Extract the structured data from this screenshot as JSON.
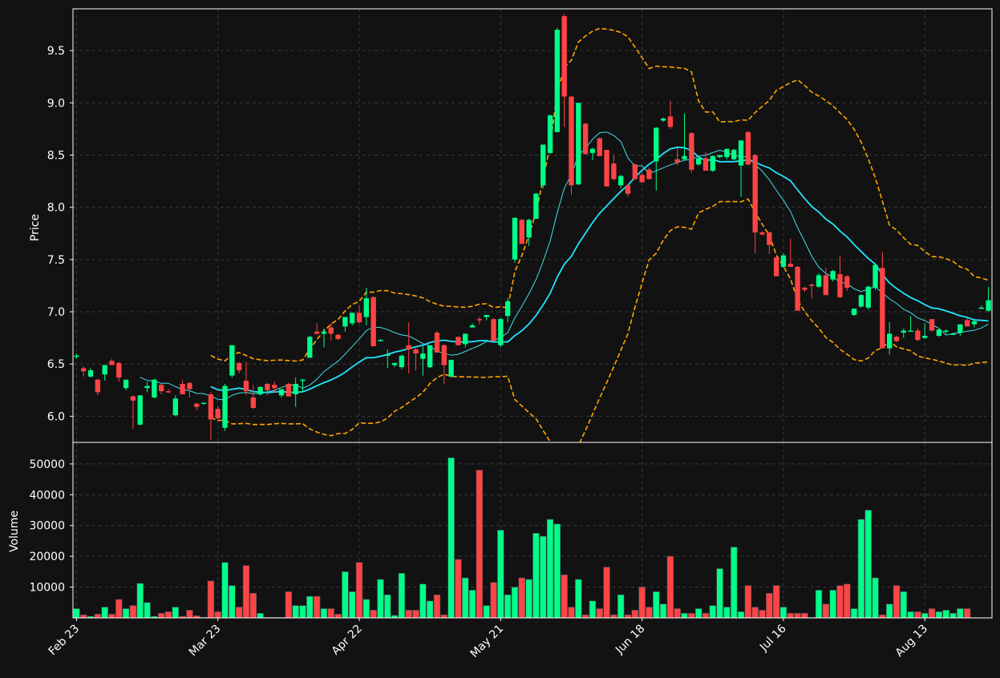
{
  "chart_data": [
    {
      "type": "candlestick",
      "panel": "price",
      "ylabel": "Price",
      "ylim": [
        5.75,
        9.9
      ],
      "yticks": [
        6.0,
        6.5,
        7.0,
        7.5,
        8.0,
        8.5,
        9.0,
        9.5
      ],
      "ytick_labels": [
        "6.0",
        "6.5",
        "7.0",
        "7.5",
        "8.0",
        "8.5",
        "9.0",
        "9.5"
      ],
      "x_tick_labels": [
        "Feb 23",
        "Mar 23",
        "Apr 22",
        "May 21",
        "Jun 18",
        "Jul 16",
        "Aug 13"
      ],
      "x_tick_indices": [
        0,
        20,
        40,
        60,
        80,
        100,
        120
      ],
      "grid": true,
      "colors": {
        "up": "#00ff88",
        "down": "#ff4444",
        "band": "#ffa500",
        "ma_short": "#40e0e8",
        "ma_long": "#22e4ff",
        "background": "#121212"
      },
      "ohlc": [
        [
          6.58,
          6.6,
          6.55,
          6.58
        ],
        [
          6.46,
          6.48,
          6.38,
          6.43
        ],
        [
          6.38,
          6.46,
          6.37,
          6.44
        ],
        [
          6.35,
          6.36,
          6.2,
          6.23
        ],
        [
          6.4,
          6.49,
          6.34,
          6.49
        ],
        [
          6.53,
          6.55,
          6.49,
          6.49
        ],
        [
          6.51,
          6.52,
          6.33,
          6.37
        ],
        [
          6.27,
          6.35,
          6.25,
          6.35
        ],
        [
          6.19,
          6.2,
          5.88,
          6.15
        ],
        [
          5.92,
          6.2,
          5.91,
          6.2
        ],
        [
          6.27,
          6.33,
          6.23,
          6.29
        ],
        [
          6.18,
          6.36,
          6.17,
          6.35
        ],
        [
          6.3,
          6.31,
          6.21,
          6.24
        ],
        [
          6.24,
          6.26,
          6.22,
          6.23
        ],
        [
          6.01,
          6.2,
          6.0,
          6.17
        ],
        [
          6.31,
          6.35,
          6.21,
          6.21
        ],
        [
          6.32,
          6.32,
          6.18,
          6.26
        ],
        [
          6.12,
          6.13,
          6.06,
          6.09
        ],
        [
          6.12,
          6.13,
          6.11,
          6.13
        ],
        [
          6.21,
          6.23,
          5.77,
          5.97
        ],
        [
          6.07,
          6.1,
          5.95,
          5.98
        ],
        [
          5.89,
          6.31,
          5.86,
          6.29
        ],
        [
          6.39,
          6.68,
          6.37,
          6.68
        ],
        [
          6.51,
          6.52,
          6.41,
          6.44
        ],
        [
          6.34,
          6.52,
          6.2,
          6.24
        ],
        [
          6.18,
          6.3,
          6.07,
          6.08
        ],
        [
          6.21,
          6.29,
          6.2,
          6.28
        ],
        [
          6.31,
          6.32,
          6.2,
          6.25
        ],
        [
          6.3,
          6.33,
          6.23,
          6.27
        ],
        [
          6.2,
          6.26,
          6.18,
          6.26
        ],
        [
          6.31,
          6.32,
          6.19,
          6.19
        ],
        [
          6.21,
          6.37,
          6.09,
          6.31
        ],
        [
          6.35,
          6.36,
          6.23,
          6.35
        ],
        [
          6.56,
          6.77,
          6.56,
          6.76
        ],
        [
          6.81,
          6.89,
          6.78,
          6.79
        ],
        [
          6.79,
          6.84,
          6.66,
          6.81
        ],
        [
          6.85,
          6.89,
          6.73,
          6.79
        ],
        [
          6.78,
          6.79,
          6.73,
          6.74
        ],
        [
          6.86,
          6.91,
          6.81,
          6.95
        ],
        [
          6.89,
          6.99,
          6.87,
          6.99
        ],
        [
          6.99,
          7.06,
          6.89,
          6.9
        ],
        [
          6.95,
          7.23,
          6.87,
          7.13
        ],
        [
          7.14,
          7.15,
          6.78,
          6.67
        ],
        [
          6.73,
          6.74,
          6.72,
          6.73
        ],
        [
          6.58,
          6.64,
          6.46,
          6.59
        ],
        [
          6.49,
          6.51,
          6.47,
          6.51
        ],
        [
          6.47,
          6.59,
          6.45,
          6.58
        ],
        [
          6.68,
          6.9,
          6.41,
          6.64
        ],
        [
          6.64,
          6.67,
          6.44,
          6.6
        ],
        [
          6.55,
          6.67,
          6.39,
          6.6
        ],
        [
          6.47,
          6.67,
          6.46,
          6.68
        ],
        [
          6.8,
          6.82,
          6.62,
          6.61
        ],
        [
          6.68,
          6.69,
          6.31,
          6.49
        ],
        [
          6.38,
          6.54,
          6.37,
          6.54
        ],
        [
          6.76,
          6.76,
          6.68,
          6.68
        ],
        [
          6.69,
          6.73,
          6.66,
          6.79
        ],
        [
          6.85,
          6.89,
          6.85,
          6.87
        ],
        [
          6.93,
          6.95,
          6.88,
          6.92
        ],
        [
          6.95,
          6.96,
          6.92,
          6.97
        ],
        [
          6.93,
          6.94,
          6.75,
          6.72
        ],
        [
          6.68,
          6.94,
          6.66,
          6.93
        ],
        [
          6.96,
          7.13,
          6.9,
          7.1
        ],
        [
          7.5,
          7.9,
          7.47,
          7.9
        ],
        [
          7.88,
          7.89,
          7.67,
          7.65
        ],
        [
          7.71,
          7.89,
          7.63,
          7.88
        ],
        [
          7.89,
          8.14,
          7.89,
          8.13
        ],
        [
          8.21,
          8.6,
          8.18,
          8.6
        ],
        [
          8.52,
          8.89,
          8.51,
          8.88
        ],
        [
          8.72,
          9.72,
          8.72,
          9.7
        ],
        [
          9.83,
          9.85,
          8.77,
          9.06
        ],
        [
          9.06,
          9.07,
          8.12,
          8.21
        ],
        [
          8.22,
          9.0,
          8.21,
          9.0
        ],
        [
          8.8,
          8.81,
          8.5,
          8.51
        ],
        [
          8.52,
          8.57,
          8.45,
          8.56
        ],
        [
          8.66,
          8.67,
          8.49,
          8.49
        ],
        [
          8.55,
          8.55,
          8.2,
          8.2
        ],
        [
          8.42,
          8.5,
          8.26,
          8.27
        ],
        [
          8.21,
          8.31,
          8.18,
          8.3
        ],
        [
          8.21,
          8.22,
          8.1,
          8.13
        ],
        [
          8.41,
          8.42,
          8.26,
          8.27
        ],
        [
          8.31,
          8.33,
          8.24,
          8.24
        ],
        [
          8.36,
          8.38,
          8.27,
          8.27
        ],
        [
          8.44,
          8.77,
          8.16,
          8.76
        ],
        [
          8.83,
          8.86,
          8.82,
          8.85
        ],
        [
          8.87,
          9.02,
          8.75,
          8.77
        ],
        [
          8.46,
          8.57,
          8.4,
          8.43
        ],
        [
          8.46,
          8.9,
          8.45,
          8.49
        ],
        [
          8.71,
          8.72,
          8.33,
          8.36
        ],
        [
          8.41,
          8.48,
          8.4,
          8.47
        ],
        [
          8.47,
          8.53,
          8.35,
          8.35
        ],
        [
          8.35,
          8.5,
          8.34,
          8.49
        ],
        [
          8.48,
          8.5,
          8.47,
          8.5
        ],
        [
          8.48,
          8.56,
          8.46,
          8.56
        ],
        [
          8.46,
          8.56,
          8.45,
          8.55
        ],
        [
          8.4,
          8.64,
          8.1,
          8.64
        ],
        [
          8.72,
          8.73,
          8.4,
          8.41
        ],
        [
          8.5,
          8.51,
          7.56,
          7.76
        ],
        [
          7.76,
          7.77,
          7.73,
          7.74
        ],
        [
          7.76,
          7.77,
          7.55,
          7.64
        ],
        [
          7.52,
          7.53,
          7.34,
          7.34
        ],
        [
          7.43,
          7.56,
          7.42,
          7.54
        ],
        [
          7.46,
          7.7,
          7.43,
          7.43
        ],
        [
          7.43,
          7.44,
          7.02,
          7.01
        ],
        [
          7.23,
          7.24,
          7.19,
          7.21
        ],
        [
          7.26,
          7.27,
          7.13,
          7.25
        ],
        [
          7.24,
          7.37,
          7.23,
          7.35
        ],
        [
          7.35,
          7.42,
          7.16,
          7.16
        ],
        [
          7.31,
          7.4,
          7.29,
          7.39
        ],
        [
          7.36,
          7.54,
          7.13,
          7.14
        ],
        [
          7.34,
          7.35,
          7.2,
          7.23
        ],
        [
          6.97,
          7.03,
          6.96,
          7.03
        ],
        [
          7.05,
          7.17,
          7.04,
          7.16
        ],
        [
          7.04,
          7.25,
          7.02,
          7.24
        ],
        [
          7.23,
          7.46,
          7.21,
          7.45
        ],
        [
          7.42,
          7.57,
          6.65,
          6.65
        ],
        [
          6.65,
          6.9,
          6.59,
          6.79
        ],
        [
          6.76,
          6.77,
          6.71,
          6.72
        ],
        [
          6.8,
          6.84,
          6.75,
          6.82
        ],
        [
          6.82,
          6.96,
          6.82,
          6.82
        ],
        [
          6.82,
          6.84,
          6.72,
          6.73
        ],
        [
          6.75,
          6.89,
          6.74,
          6.77
        ],
        [
          6.93,
          6.93,
          6.81,
          6.82
        ],
        [
          6.77,
          6.83,
          6.76,
          6.83
        ],
        [
          6.81,
          6.83,
          6.79,
          6.82
        ],
        [
          6.79,
          6.8,
          6.78,
          6.79
        ],
        [
          6.8,
          6.88,
          6.77,
          6.88
        ],
        [
          6.92,
          6.94,
          6.86,
          6.86
        ],
        [
          6.88,
          6.92,
          6.85,
          6.91
        ],
        [
          7.04,
          7.06,
          7.03,
          7.04
        ],
        [
          7.01,
          7.24,
          7.0,
          7.11
        ]
      ],
      "overlays": [
        "moving-average-short",
        "moving-average-long",
        "bollinger-upper",
        "bollinger-lower"
      ]
    },
    {
      "type": "bar",
      "panel": "volume",
      "ylabel": "Volume",
      "ylim": [
        0,
        57000
      ],
      "yticks": [
        10000,
        20000,
        30000,
        40000,
        50000
      ],
      "ytick_labels": [
        "10000",
        "20000",
        "30000",
        "40000",
        "50000"
      ],
      "grid": true,
      "values": [
        3000,
        1000,
        500,
        1200,
        3500,
        1200,
        6000,
        3000,
        4000,
        11200,
        5000,
        500,
        1500,
        2000,
        3500,
        500,
        2500,
        700,
        200,
        12000,
        2000,
        18000,
        10500,
        3500,
        17000,
        8000,
        1500,
        200,
        200,
        200,
        8500,
        4000,
        4000,
        7000,
        7000,
        3000,
        3000,
        1200,
        15000,
        8500,
        18000,
        6000,
        2500,
        12500,
        7500,
        800,
        14500,
        2500,
        2500,
        11000,
        5500,
        7500,
        1000,
        52000,
        19000,
        13000,
        9000,
        48000,
        4000,
        11500,
        28500,
        7500,
        10000,
        13000,
        12500,
        27500,
        26500,
        32000,
        30500,
        14000,
        3500,
        12500,
        1000,
        5500,
        3000,
        16500,
        1000,
        7500,
        1000,
        2500,
        10000,
        3500,
        8500,
        4500,
        20000,
        3000,
        1500,
        1500,
        3000,
        1500,
        4000,
        16000,
        3500,
        23000,
        2000,
        10500,
        3500,
        2500,
        8000,
        10500,
        3500,
        1500,
        1500,
        1500,
        100,
        9000,
        4500,
        9000,
        10500,
        11000,
        3000,
        32000,
        35000,
        13000,
        1000,
        4500,
        10500,
        8500,
        2000,
        2000,
        1500,
        3000,
        2000,
        2500,
        1500,
        3000,
        3000
      ]
    }
  ]
}
